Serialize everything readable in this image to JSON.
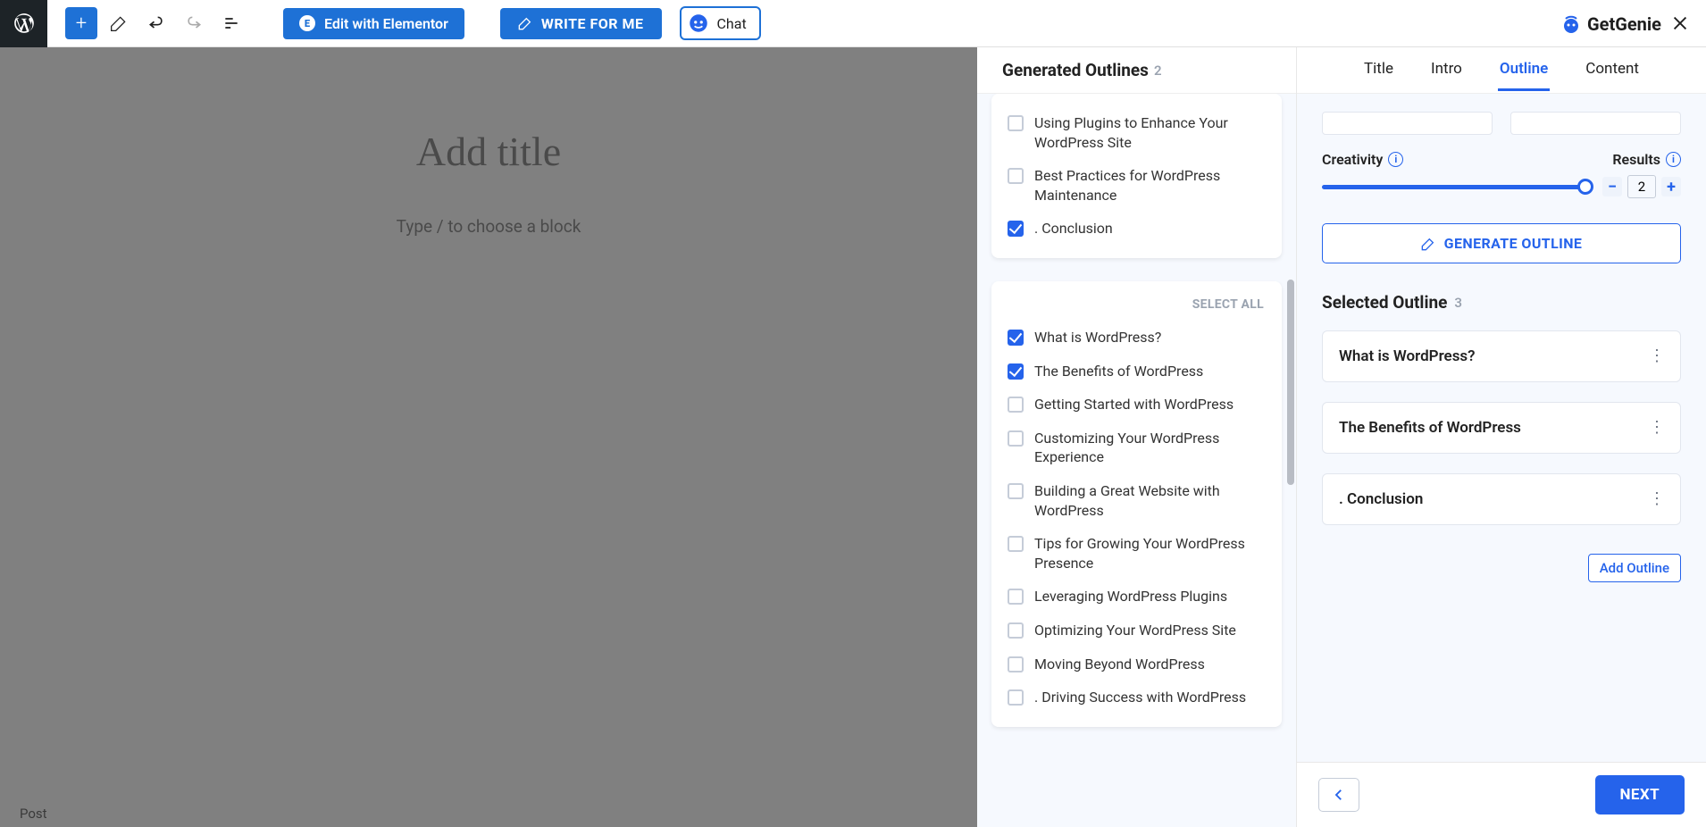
{
  "toolbar": {
    "elementor_label": "Edit with Elementor",
    "write_label": "WRITE FOR ME",
    "chat_label": "Chat"
  },
  "brand": {
    "name": "GetGenie"
  },
  "editor": {
    "title_placeholder": "Add title",
    "block_placeholder": "Type / to choose a block",
    "footer_type": "Post"
  },
  "tabs": [
    "Title",
    "Intro",
    "Outline",
    "Content"
  ],
  "active_tab": "Outline",
  "generated_heading": "Generated Outlines",
  "generated_count": "2",
  "select_all_label": "SELECT ALL",
  "generated_groups": [
    {
      "show_header": false,
      "items": [
        {
          "label": "Using Plugins to Enhance Your WordPress Site",
          "checked": false
        },
        {
          "label": "Best Practices for WordPress Maintenance",
          "checked": false
        },
        {
          "label": ". Conclusion",
          "checked": true
        }
      ]
    },
    {
      "show_header": true,
      "items": [
        {
          "label": "What is WordPress?",
          "checked": true
        },
        {
          "label": "The Benefits of WordPress",
          "checked": true
        },
        {
          "label": "Getting Started with WordPress",
          "checked": false
        },
        {
          "label": "Customizing Your WordPress Experience",
          "checked": false
        },
        {
          "label": "Building a Great Website with WordPress",
          "checked": false
        },
        {
          "label": "Tips for Growing Your WordPress Presence",
          "checked": false
        },
        {
          "label": "Leveraging WordPress Plugins",
          "checked": false
        },
        {
          "label": "Optimizing Your WordPress Site",
          "checked": false
        },
        {
          "label": "Moving Beyond WordPress",
          "checked": false
        },
        {
          "label": ". Driving Success with WordPress",
          "checked": false
        }
      ]
    }
  ],
  "controls": {
    "creativity_label": "Creativity",
    "results_label": "Results",
    "results_value": "2",
    "generate_label": "GENERATE OUTLINE"
  },
  "selected_heading": "Selected Outline",
  "selected_count": "3",
  "selected_items": [
    "What is WordPress?",
    "The Benefits of WordPress",
    ". Conclusion"
  ],
  "add_outline_label": "Add Outline",
  "footer": {
    "next_label": "NEXT"
  }
}
